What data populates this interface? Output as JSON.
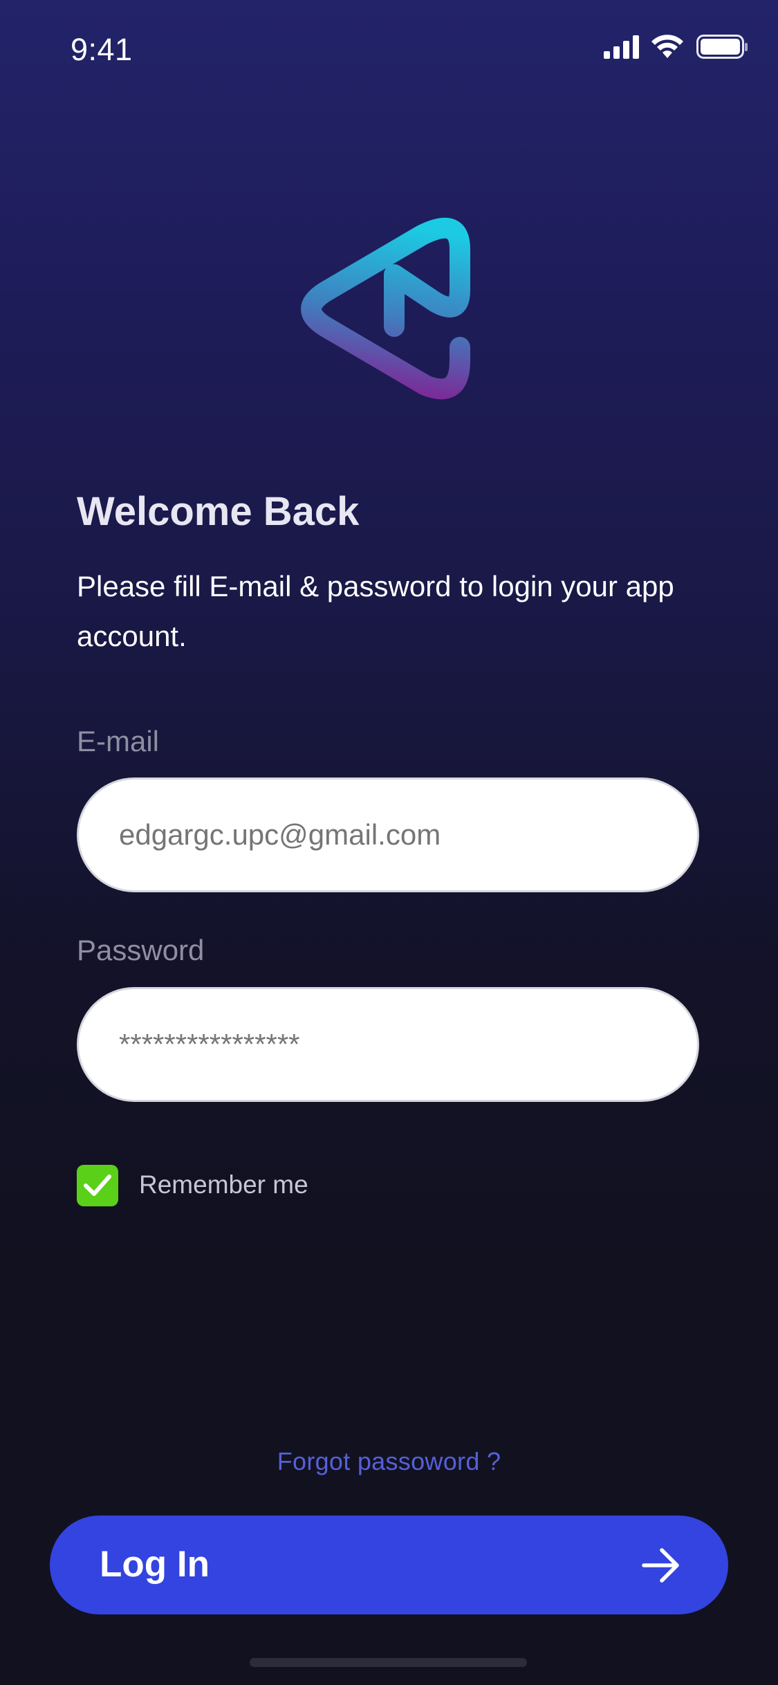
{
  "status_bar": {
    "time": "9:41"
  },
  "logo": {
    "icon": "play-triangle-logo",
    "gradient_colors": [
      "#1fc8e2",
      "#5b4bb0",
      "#7a2f96"
    ]
  },
  "welcome": {
    "title": "Welcome Back",
    "subtitle": "Please fill E-mail & password to login your app account."
  },
  "email": {
    "label": "E-mail",
    "placeholder": "edgargc.upc@gmail.com"
  },
  "password": {
    "label": "Password",
    "placeholder": "****************"
  },
  "remember": {
    "label": "Remember me",
    "checked": true,
    "color": "#5ad018"
  },
  "forgot": {
    "label": "Forgot passoword ?"
  },
  "login": {
    "label": "Log In",
    "icon": "arrow-right-icon",
    "color": "#3344e0"
  }
}
